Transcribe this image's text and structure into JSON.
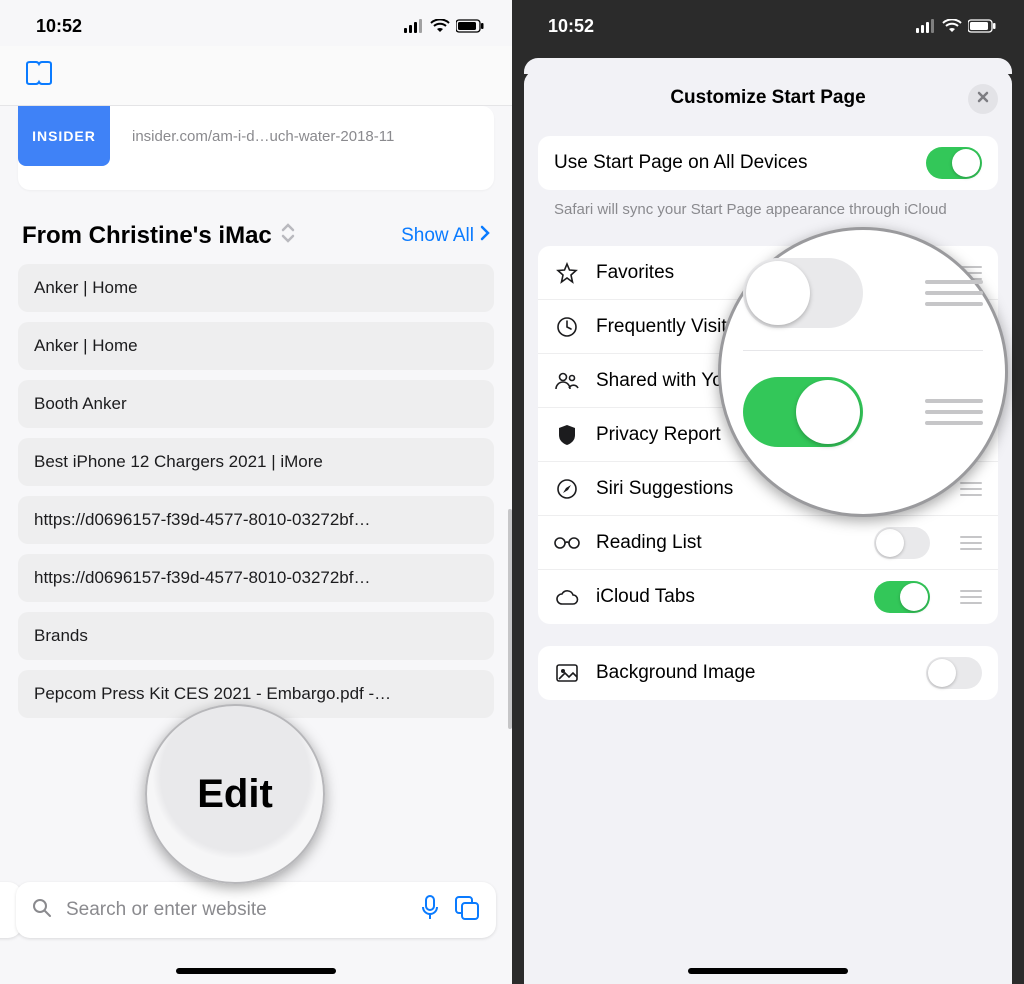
{
  "status": {
    "time": "10:52"
  },
  "left": {
    "insider": {
      "badge": "INSIDER",
      "url": "insider.com/am-i-d…uch-water-2018-11"
    },
    "section_title": "From Christine's iMac",
    "show_all": "Show All",
    "tabs": [
      "Anker | Home",
      "Anker | Home",
      "Booth Anker",
      "Best iPhone 12 Chargers 2021 | iMore",
      "https://d0696157-f39d-4577-8010-03272bf…",
      "https://d0696157-f39d-4577-8010-03272bf…",
      "Brands",
      "Pepcom Press Kit CES 2021 - Embargo.pdf -…"
    ],
    "edit_label": "Edit",
    "search_placeholder": "Search or enter website"
  },
  "right": {
    "sheet_title": "Customize Start Page",
    "sync_label": "Use Start Page on All Devices",
    "sync_note": "Safari will sync your Start Page appearance through iCloud",
    "rows": {
      "favorites": "Favorites",
      "freq": "Frequently Visited",
      "shared": "Shared with You",
      "privacy": "Privacy Report",
      "siri": "Siri Suggestions",
      "reading": "Reading List",
      "icloud": "iCloud Tabs",
      "bg": "Background Image"
    },
    "toggles": {
      "sync": true,
      "favorites": true,
      "freq": false,
      "shared": true,
      "privacy": true,
      "siri": true,
      "reading": false,
      "icloud": true,
      "bg": false
    }
  }
}
